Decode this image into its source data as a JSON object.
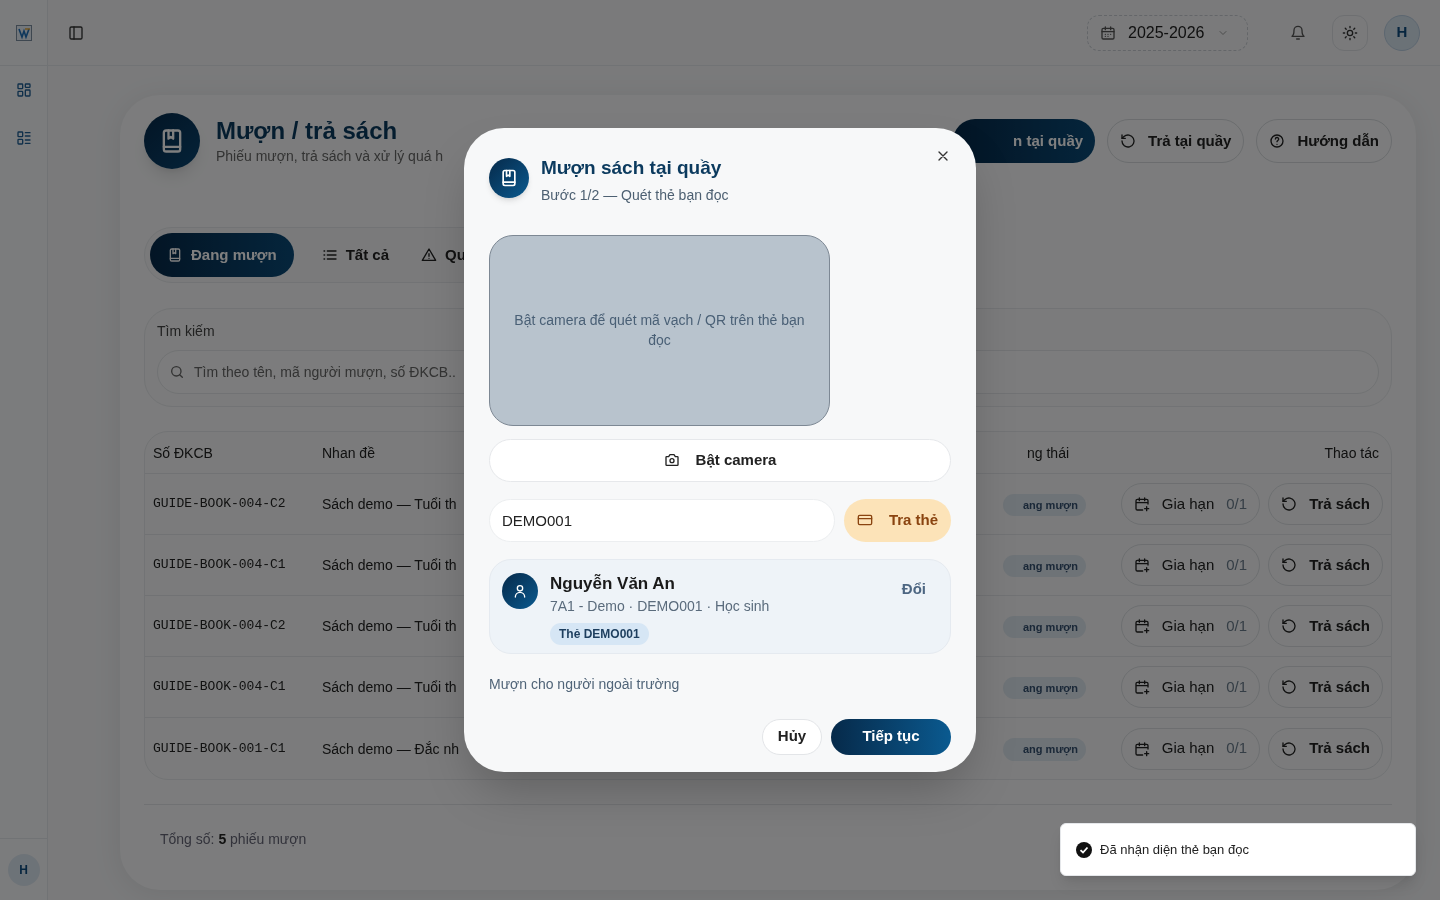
{
  "topbar": {
    "school_year": "2025-2026",
    "avatar": "H"
  },
  "sidebar": {
    "avatar": "H"
  },
  "page": {
    "title": "Mượn / trả sách",
    "subtitle": "Phiếu mượn, trả sách và xử lý quá h",
    "actions": [
      {
        "label": "n tại quầy",
        "kind": "primary"
      },
      {
        "label": "Trả tại quầy",
        "kind": "outline"
      },
      {
        "label": "Hướng dẫn",
        "kind": "outline"
      }
    ]
  },
  "tabs": [
    {
      "label": "Đang mượn",
      "selected": true
    },
    {
      "label": "Tất cả",
      "selected": false
    },
    {
      "label": "Qu",
      "selected": false
    }
  ],
  "search": {
    "label": "Tìm kiếm",
    "placeholder": "Tìm theo tên, mã người mượn, số ĐKCB.."
  },
  "table": {
    "columns": [
      "Số ĐKCB",
      "Nhan đề",
      "ng thái",
      "Thao tác"
    ],
    "rows": [
      {
        "code": "GUIDE-BOOK-004-C2",
        "title": "Sách demo — Tuổi th",
        "status": "ang mượn",
        "extend": "Gia hạn",
        "extend_count": "0/1",
        "return": "Trả sách"
      },
      {
        "code": "GUIDE-BOOK-004-C1",
        "title": "Sách demo — Tuổi th",
        "status": "ang mượn",
        "extend": "Gia hạn",
        "extend_count": "0/1",
        "return": "Trả sách"
      },
      {
        "code": "GUIDE-BOOK-004-C2",
        "title": "Sách demo — Tuổi th",
        "status": "ang mượn",
        "extend": "Gia hạn",
        "extend_count": "0/1",
        "return": "Trả sách"
      },
      {
        "code": "GUIDE-BOOK-004-C1",
        "title": "Sách demo — Tuổi th",
        "status": "ang mượn",
        "extend": "Gia hạn",
        "extend_count": "0/1",
        "return": "Trả sách"
      },
      {
        "code": "GUIDE-BOOK-001-C1",
        "title": "Sách demo — Đắc nh",
        "status": "ang mượn",
        "extend": "Gia hạn",
        "extend_count": "0/1",
        "return": "Trả sách"
      }
    ]
  },
  "footer": {
    "total": "Tổng số: **5** phiếu mượn"
  },
  "dialog": {
    "title": "Mượn sách tại quầy",
    "subtitle": "Bước 1/2 — Quét thẻ bạn đọc",
    "scanner_hint": "Bật camera để quét mã vạch / QR trên thẻ bạn đọc",
    "camera_button": "Bật camera",
    "card_input": {
      "value": "DEMO001"
    },
    "lookup_button": "Tra thẻ",
    "reader": {
      "name": "Nguyễn Văn An",
      "details": "7A1 - Demo · DEMO001 · Học sinh",
      "card_badge": "Thẻ DEMO001",
      "change_link": "Đổi"
    },
    "guest_link": "Mượn cho người ngoài trường",
    "buttons": [
      {
        "label": "Hủy",
        "kind": "secondary"
      },
      {
        "label": "Tiếp tục",
        "kind": "primary"
      }
    ]
  },
  "toast": {
    "message": "Đã nhận diện thẻ bạn đọc"
  }
}
